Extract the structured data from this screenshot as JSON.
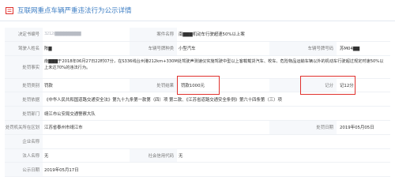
{
  "header": {
    "title": "互联网重点车辆严重违法行为公示详情",
    "icon": "doc-icon",
    "accent": "#3f7fc4"
  },
  "rows": {
    "decision_no": {
      "label": "决定书编号",
      "value": "3212(▇▇▇▇▇▇▇▇▇"
    },
    "case_name": {
      "label": "案件名称",
      "value": "南▇▇▇机动车行驶超速50%以上案"
    },
    "party_name": {
      "label": "驾驶人姓名",
      "value": "陈▇"
    },
    "vehicle_type": {
      "label": "车辆号牌种类",
      "value": "小型汽车"
    },
    "plate_no": {
      "label": "车辆号牌号码",
      "value": "苏M04▇▇"
    },
    "facts": {
      "label": "处罚事实",
      "value": "南▇▇▇于2018年06月27日22时07分，在S336线台州港212km+330M处驾驶声测速仪实施驾驶中型以上客载载货汽车、校车、危险物品运输车辆以外的机动车行驶超过规定时速50%以上未达70%的违法行为。"
    },
    "penalty_type": {
      "label": "处罚类别",
      "value": "罚款"
    },
    "penalty_result": {
      "label": "处罚结果",
      "value": "罚款1000元"
    },
    "points": {
      "label": "记分",
      "value": "记12分"
    },
    "basis": {
      "label": "处罚依据",
      "value": "《中华人民共和国道路交通安全法》第九十九条第一款第（四）项 第二款、《江苏省道路交通安全条例》第六十四条第（三）项"
    },
    "dept": {
      "label": "处罚部门",
      "value": "靖江市公安局交通警察大队"
    },
    "region": {
      "label": "处罚机关所在区划",
      "value": "江苏省泰州市靖江市"
    },
    "date": {
      "label": "处罚日期",
      "value": "2019年05月05日"
    },
    "company": {
      "label": "企业名称",
      "value": ""
    },
    "legal_person": {
      "label": "法人名称",
      "value": "无"
    },
    "credit_code": {
      "label": "社会信用代码",
      "value": "无"
    },
    "publish_date": {
      "label": "公示日期",
      "value": "2019年05月17日"
    }
  },
  "colors": {
    "highlight": "#e0312d",
    "label_bg": "#f6f8fb"
  }
}
